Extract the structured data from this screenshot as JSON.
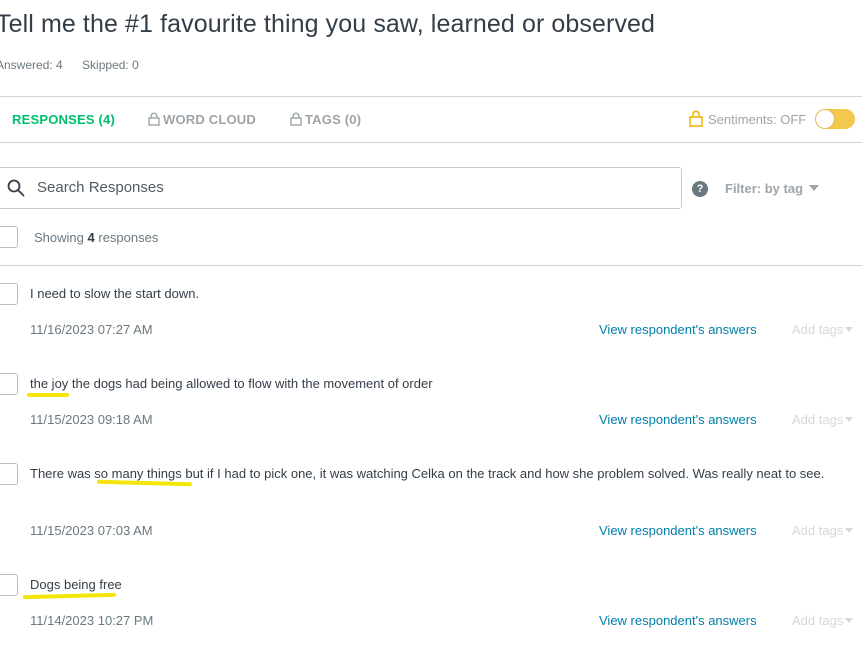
{
  "header": {
    "title": "Tell me the #1 favourite thing you saw, learned or observed",
    "answered": "Answered: 4",
    "skipped": "Skipped: 0"
  },
  "tabs": {
    "responses": "RESPONSES (4)",
    "word_cloud": "WORD CLOUD",
    "tags": "TAGS (0)",
    "sentiments": "Sentiments: OFF",
    "sentiments_on": false
  },
  "search": {
    "placeholder": "Search Responses",
    "value": ""
  },
  "filter": {
    "label": "Filter: by tag"
  },
  "help": {
    "glyph": "?"
  },
  "summary": {
    "prefix": "Showing",
    "count": "4",
    "suffix": "responses"
  },
  "responses": [
    {
      "text": "I need to slow the start down.",
      "date": "11/16/2023 07:27 AM"
    },
    {
      "text": "the joy the dogs had being allowed to flow with the movement of order",
      "date": "11/15/2023 09:18 AM"
    },
    {
      "text": "There was so many things but if I had to pick one, it was watching Celka on the track and how she problem solved. Was really neat to see.",
      "date": "11/15/2023 07:03 AM"
    },
    {
      "text": "Dogs being free",
      "date": "11/14/2023 10:27 PM"
    }
  ],
  "actions": {
    "view_label": "View respondent's answers",
    "tags_label": "Add tags"
  },
  "colors": {
    "accent": "#00bf6f",
    "link": "#007faa",
    "toggle": "#f2c94c",
    "highlight": "#f5e50a"
  }
}
